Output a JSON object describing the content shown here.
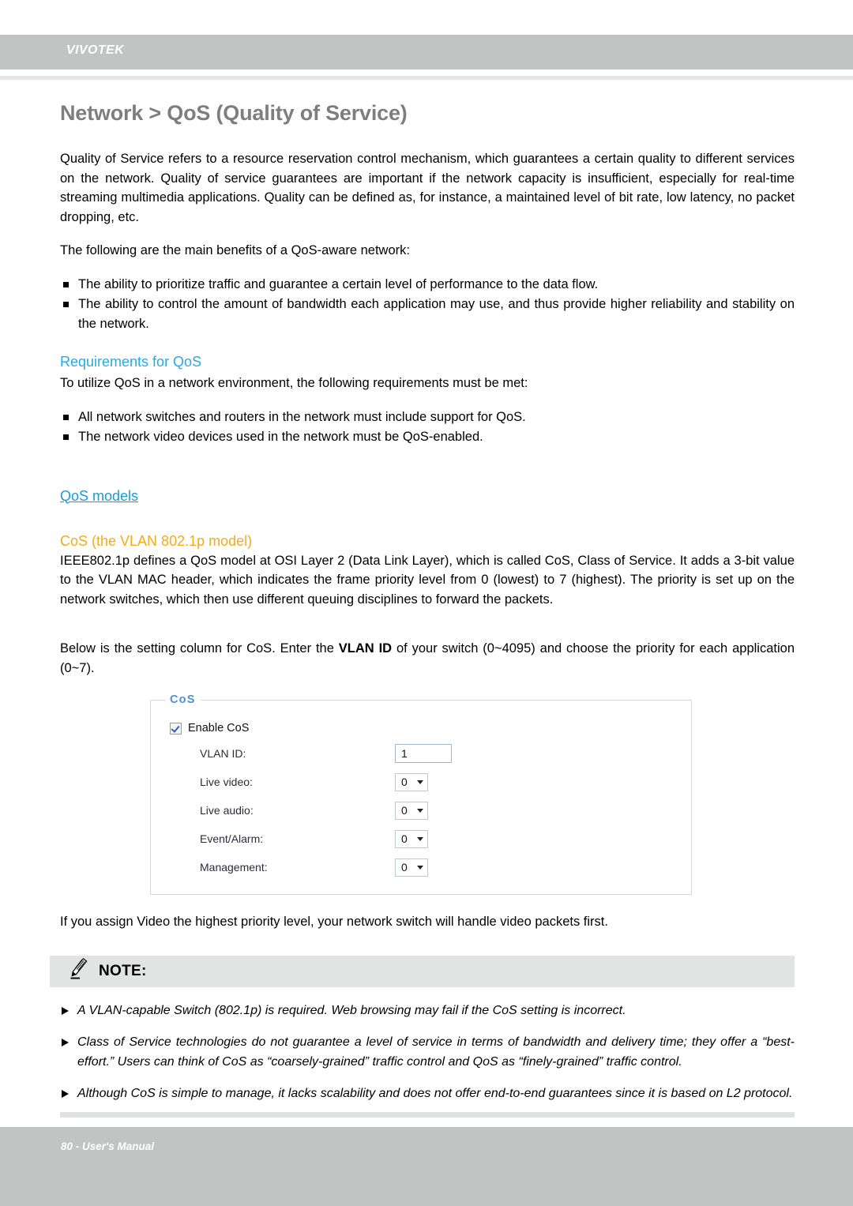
{
  "header": {
    "brand": "VIVOTEK"
  },
  "page": {
    "title": "Network > QoS (Quality of Service)"
  },
  "intro": {
    "paragraph": "Quality of Service refers to a resource reservation control mechanism, which guarantees a certain quality to different services on the network. Quality of service guarantees are important if the network capacity is insufficient, especially for real-time streaming multimedia applications. Quality can be defined as, for instance, a maintained level of bit rate, low latency, no packet dropping, etc.",
    "benefits_lead": "The following are the main benefits of a QoS-aware network:",
    "benefits": [
      "The ability to prioritize traffic and guarantee a certain level of performance to the data flow.",
      "The ability to control the amount of bandwidth each application may use, and thus provide higher reliability and stability on the network."
    ]
  },
  "requirements": {
    "heading": "Requirements for QoS",
    "lead": "To utilize QoS in a network environment, the following requirements must be met:",
    "items": [
      "All network switches and routers in the network must include support for QoS.",
      "The network video devices used in the network must be QoS-enabled."
    ]
  },
  "models": {
    "heading": "QoS models",
    "cos_heading": "CoS (the VLAN 802.1p model)",
    "cos_paragraph": "IEEE802.1p defines a QoS model at OSI Layer 2 (Data Link Layer), which is called CoS, Class of Service. It adds a 3-bit value to the VLAN MAC header, which indicates the frame priority level from 0 (lowest) to 7 (highest). The priority is set up on the network switches, which then use different queuing disciplines to forward the packets.",
    "setting_line_1": "Below is the setting column for CoS. Enter the ",
    "setting_bold": "VLAN ID",
    "setting_line_2": " of your switch (0~4095) and choose the priority for each application (0~7)."
  },
  "cos_panel": {
    "legend": "CoS",
    "enable_label": "Enable CoS",
    "enable_checked": true,
    "fields": [
      {
        "label": "VLAN ID:",
        "value": "1",
        "type": "text"
      },
      {
        "label": "Live video:",
        "value": "0",
        "type": "select"
      },
      {
        "label": "Live audio:",
        "value": "0",
        "type": "select"
      },
      {
        "label": "Event/Alarm:",
        "value": "0",
        "type": "select"
      },
      {
        "label": "Management:",
        "value": "0",
        "type": "select"
      }
    ]
  },
  "after_panel": {
    "paragraph": "If you assign Video the highest priority level, your network switch will handle video packets first."
  },
  "note": {
    "title": "NOTE:",
    "items": [
      "A VLAN-capable Switch (802.1p) is required. Web browsing may fail if the CoS setting is incorrect.",
      "Class of Service technologies do not guarantee a level of service in terms of bandwidth and delivery time; they offer a “best-effort.” Users can think of CoS as “coarsely-grained” traffic control and QoS as “finely-grained” traffic control.",
      "Although CoS is simple to manage, it lacks scalability and does not offer end-to-end guarantees since it is based on L2 protocol."
    ]
  },
  "footer": {
    "text": "80 - User's Manual"
  },
  "colors": {
    "band_gray": "#c2c3c3",
    "title_gray": "#7e7e7e",
    "accent_blue": "#2ca8e0",
    "accent_orange": "#f5ab19",
    "note_bar": "#e2e3e3",
    "panel_legend_blue": "#4a90d9"
  }
}
